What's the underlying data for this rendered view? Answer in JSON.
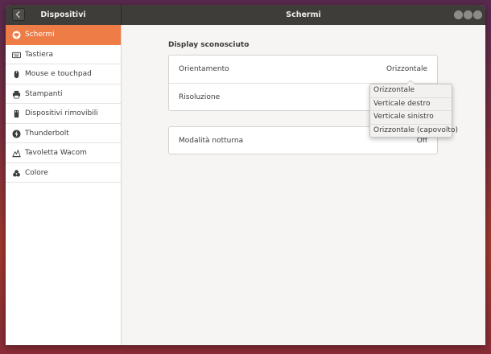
{
  "titlebar": {
    "sidebar_title": "Dispositivi",
    "main_title": "Schermi"
  },
  "sidebar": {
    "items": [
      {
        "label": "Schermi",
        "icon": "display-icon",
        "active": true
      },
      {
        "label": "Tastiera",
        "icon": "keyboard-icon"
      },
      {
        "label": "Mouse e touchpad",
        "icon": "mouse-icon"
      },
      {
        "label": "Stampanti",
        "icon": "printer-icon"
      },
      {
        "label": "Dispositivi rimovibili",
        "icon": "removable-media-icon"
      },
      {
        "label": "Thunderbolt",
        "icon": "thunderbolt-icon"
      },
      {
        "label": "Tavoletta Wacom",
        "icon": "tablet-icon"
      },
      {
        "label": "Colore",
        "icon": "color-icon"
      }
    ]
  },
  "main": {
    "section_title": "Display sconosciuto",
    "orientation": {
      "label": "Orientamento",
      "value": "Orizzontale"
    },
    "resolution": {
      "label": "Risoluzione"
    },
    "night_mode": {
      "label": "Modalità notturna",
      "value": "Off"
    }
  },
  "orientation_popover": {
    "options": [
      "Orizzontale",
      "Verticale destro",
      "Verticale sinistro",
      "Orizzontale (capovolto)"
    ]
  },
  "colors": {
    "accent": "#ee7c47",
    "titlebar": "#3e3d3a",
    "background": "#f6f5f4"
  }
}
